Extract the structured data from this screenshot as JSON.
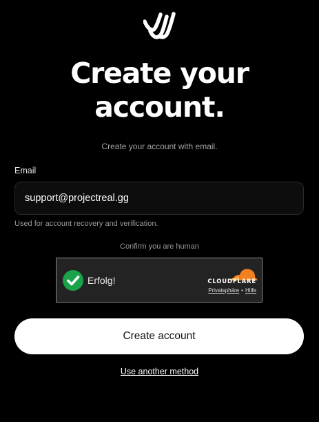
{
  "logo": {
    "icon": "brand-stripes-logo-icon"
  },
  "heading": {
    "line1": "Create your",
    "line2": "account."
  },
  "subtitle": "Create your account with email.",
  "email": {
    "label": "Email",
    "value": "support@projectreal.gg",
    "helper": "Used for account recovery and verification."
  },
  "captcha": {
    "caption": "Confirm you are human",
    "status": "Erfolg!",
    "status_icon": "success-check-icon",
    "brand": "CLOUDFLARE",
    "privacy_link": "Privatsphäre",
    "separator": "•",
    "help_link": "Hilfe",
    "check_color": "#1aa34a",
    "cloud_color": "#f38020"
  },
  "actions": {
    "create_account": "Create account",
    "another_method": "Use another method"
  },
  "colors": {
    "background": "#000000",
    "primary_button": "#ffffff",
    "muted_text": "#a3a3a3"
  }
}
